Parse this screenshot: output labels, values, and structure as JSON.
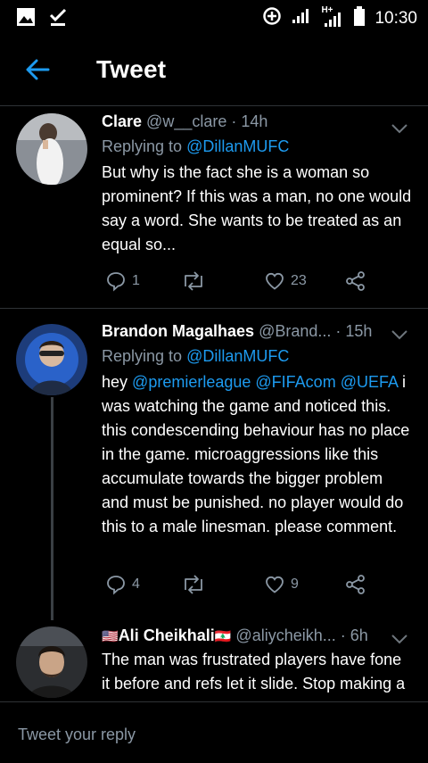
{
  "status_bar": {
    "time": "10:30",
    "network": "H+"
  },
  "header": {
    "title": "Tweet"
  },
  "tweets": [
    {
      "name": "Clare",
      "handle": "@w__clare",
      "time": "· 14h",
      "replying_prefix": "Replying to",
      "replying_to": "@DillanMUFC",
      "body": "But why is the fact she is a woman so prominent? If this was a man, no one would say a word. She wants to be treated as an equal so...",
      "reply_count": "1",
      "retweet_count": "",
      "like_count": "23"
    },
    {
      "name": "Brandon Magalhaes",
      "handle": "@Brand...",
      "time": "· 15h",
      "replying_prefix": "Replying to",
      "replying_to": "@DillanMUFC",
      "body_start": "hey",
      "mention_1": "@premierleague",
      "mention_2": "@FIFAcom",
      "mention_3": "@UEFA",
      "body_rest": "i was watching the game and noticed this. this condescending behaviour has no place in the game. microaggressions like this accumulate towards the bigger problem and must be punished. no player would do this to a male linesman. please comment.",
      "reply_count": "4",
      "retweet_count": "",
      "like_count": "9"
    },
    {
      "name_flag_left": "🇺🇸",
      "name": "Ali Cheikhali",
      "name_flag_right": "🇱🇧",
      "handle": "@aliycheikh...",
      "time": "· 6h",
      "body": "The man was frustrated players have fone it before and refs let it slide. Stop making a big deal out of something. It"
    }
  ],
  "reply_bar": {
    "placeholder": "Tweet your reply"
  },
  "colors": {
    "background": "#000000",
    "accent": "#1d9bf0",
    "secondary_text": "#8b98a5",
    "divider": "#2f3336"
  }
}
